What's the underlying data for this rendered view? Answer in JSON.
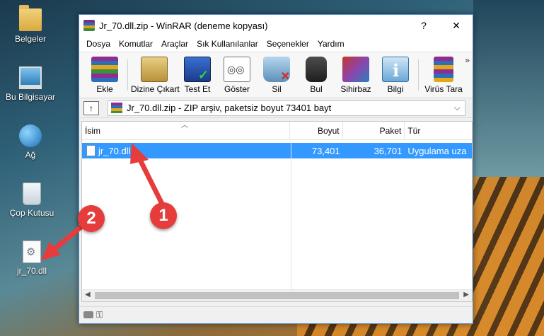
{
  "desktop": {
    "icons": [
      {
        "label": "Belgeler",
        "icon": "folder-icon"
      },
      {
        "label": "Bu Bilgisayar",
        "icon": "computer-icon"
      },
      {
        "label": "Ağ",
        "icon": "network-icon"
      },
      {
        "label": "Çop Kutusu",
        "icon": "recycle-bin-icon"
      },
      {
        "label": "jr_70.dll",
        "icon": "dll-file-icon"
      }
    ]
  },
  "window": {
    "title": "Jr_70.dll.zip - WinRAR (deneme kopyası)",
    "help_btn": "?",
    "close_btn": "✕",
    "minimize_btn": "—"
  },
  "menu": [
    "Dosya",
    "Komutlar",
    "Araçlar",
    "Sık Kullanılanlar",
    "Seçenekler",
    "Yardım"
  ],
  "toolbar": [
    {
      "label": "Ekle",
      "icon": "add-icon"
    },
    {
      "label": "Dizine Çıkart",
      "icon": "extract-icon"
    },
    {
      "label": "Test Et",
      "icon": "test-icon"
    },
    {
      "label": "Göster",
      "icon": "view-icon"
    },
    {
      "label": "Sil",
      "icon": "delete-icon"
    },
    {
      "label": "Bul",
      "icon": "find-icon"
    },
    {
      "label": "Sihirbaz",
      "icon": "wizard-icon"
    },
    {
      "label": "Bilgi",
      "icon": "info-icon"
    },
    {
      "label": "Virüs Tara",
      "icon": "virus-scan-icon"
    }
  ],
  "toolbar_more": "»",
  "address": {
    "up_label": "↑",
    "path": "Jr_70.dll.zip - ZIP arşiv, paketsiz boyut 73401 bayt",
    "chevron": "⌵"
  },
  "list": {
    "columns": {
      "name": "İsim",
      "size": "Boyut",
      "packed": "Paket",
      "type": "Tür"
    },
    "rows": [
      {
        "name": "jr_70.dll",
        "size": "73,401",
        "packed": "36,701",
        "type": "Uygulama uza"
      }
    ]
  },
  "annotations": {
    "badge1": "1",
    "badge2": "2",
    "color": "#e63c3c"
  }
}
